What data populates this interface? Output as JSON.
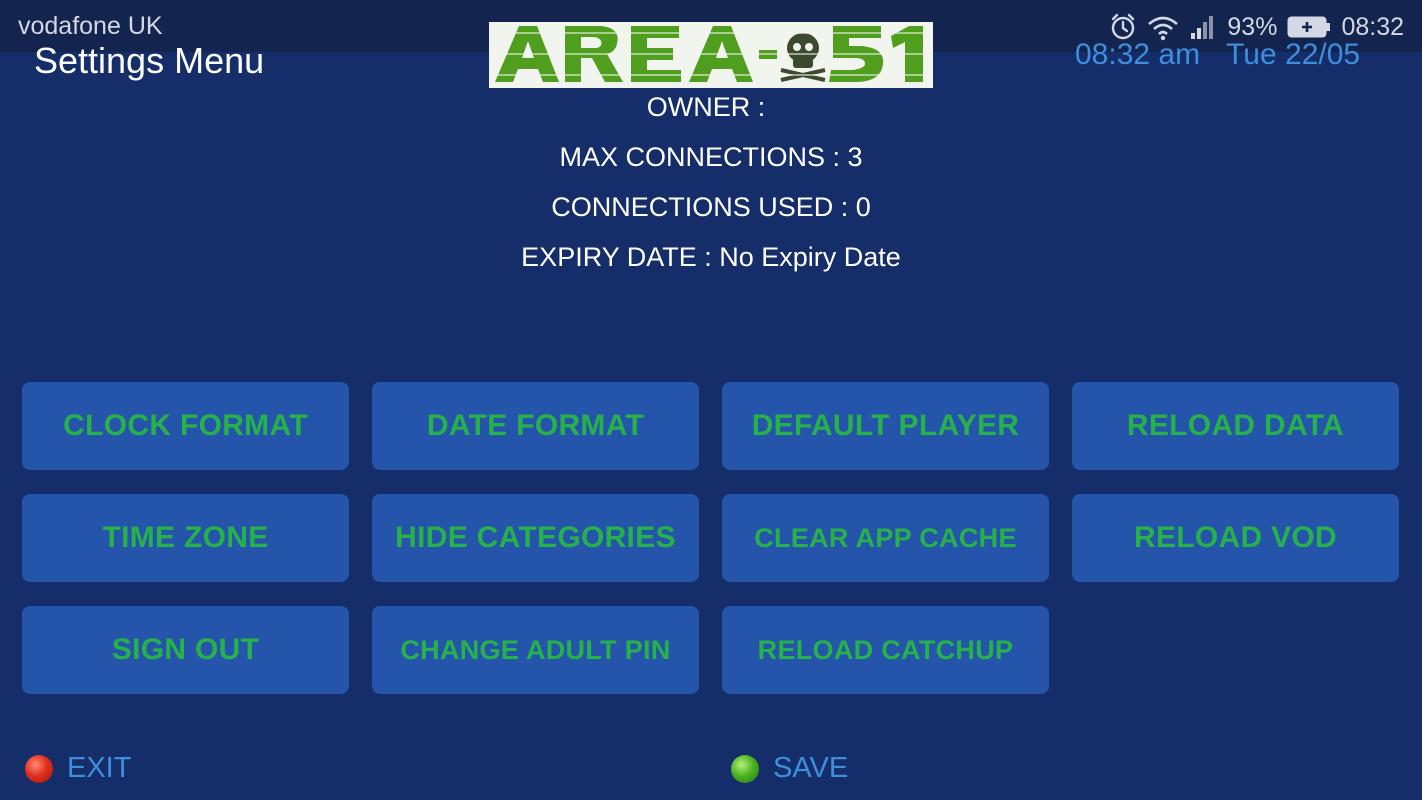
{
  "statusbar": {
    "carrier": "vodafone UK",
    "battery": "93%",
    "time": "08:32",
    "icons": [
      "alarm-icon",
      "wifi-icon",
      "signal-icon",
      "battery-icon"
    ]
  },
  "header": {
    "title": "Settings Menu",
    "logo_text": "AREA-51",
    "clock_time": "08:32 am",
    "clock_date": "Tue 22/05"
  },
  "account": {
    "owner_label": "OWNER :",
    "owner_value": "",
    "max_connections": "MAX CONNECTIONS : 3",
    "connections_used": "CONNECTIONS USED : 0",
    "expiry_date": "EXPIRY DATE : No Expiry Date"
  },
  "buttons": [
    "CLOCK FORMAT",
    "DATE FORMAT",
    "DEFAULT PLAYER",
    "RELOAD DATA",
    "TIME ZONE",
    "HIDE CATEGORIES",
    "CLEAR APP CACHE",
    "RELOAD VOD",
    "SIGN OUT",
    "CHANGE ADULT PIN",
    "RELOAD CATCHUP"
  ],
  "footer": {
    "exit_label": "EXIT",
    "save_label": "SAVE"
  },
  "colors": {
    "background": "#152d68",
    "button_bg": "#2555aa",
    "button_text": "#27b14a",
    "accent_blue": "#3d8fdd"
  }
}
